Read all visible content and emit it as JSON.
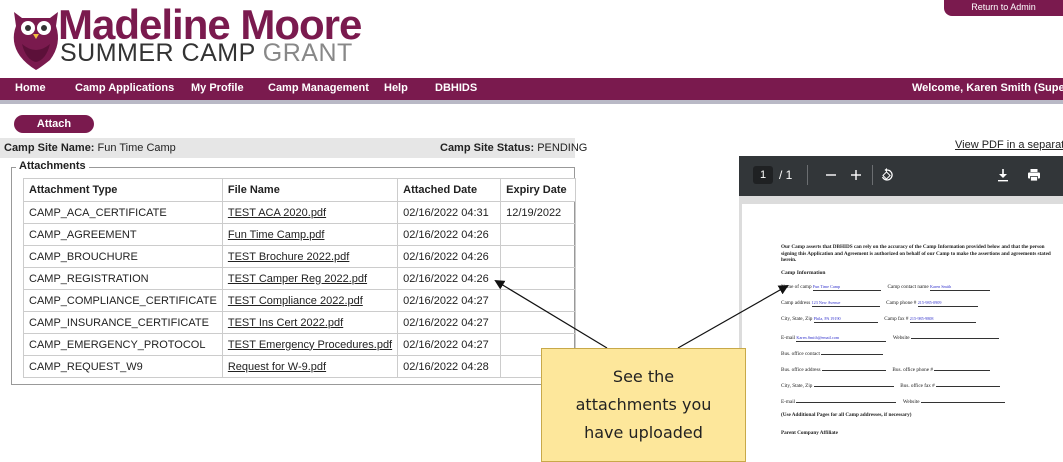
{
  "brand": {
    "name": "Madeline Moore",
    "sub_main": "SUMMER CAMP",
    "sub_light": "GRANT",
    "owl_icon": "owl-logo-icon",
    "color": "#7a1a4e"
  },
  "header": {
    "top_right_label": "Return to Admin"
  },
  "nav": {
    "items": [
      {
        "label": "Home"
      },
      {
        "label": "Camp Applications"
      },
      {
        "label": "My Profile"
      },
      {
        "label": "Camp Management"
      },
      {
        "label": "Help"
      },
      {
        "label": "DBHIDS"
      }
    ],
    "welcome": "Welcome, Karen Smith (Super Ac"
  },
  "actions": {
    "attach_label": "Attach"
  },
  "site": {
    "name_label": "Camp Site Name:",
    "name_value": "Fun Time Camp",
    "status_label": "Camp Site Status:",
    "status_value": "PENDING",
    "pdf_link": "View PDF in a separate wi"
  },
  "attachments": {
    "legend": "Attachments",
    "columns": [
      "Attachment Type",
      "File Name",
      "Attached Date",
      "Expiry Date"
    ],
    "rows": [
      {
        "type": "CAMP_ACA_CERTIFICATE",
        "file": "TEST ACA 2020.pdf",
        "attached": "02/16/2022 04:31",
        "expiry": "12/19/2022"
      },
      {
        "type": "CAMP_AGREEMENT",
        "file": "Fun Time Camp.pdf",
        "attached": "02/16/2022 04:26",
        "expiry": ""
      },
      {
        "type": "CAMP_BROUCHURE",
        "file": "TEST Brochure 2022.pdf",
        "attached": "02/16/2022 04:26",
        "expiry": ""
      },
      {
        "type": "CAMP_REGISTRATION",
        "file": "TEST Camper Reg 2022.pdf",
        "attached": "02/16/2022 04:26",
        "expiry": ""
      },
      {
        "type": "CAMP_COMPLIANCE_CERTIFICATE",
        "file": "TEST Compliance 2022.pdf",
        "attached": "02/16/2022 04:27",
        "expiry": ""
      },
      {
        "type": "CAMP_INSURANCE_CERTIFICATE",
        "file": "TEST Ins Cert 2022.pdf",
        "attached": "02/16/2022 04:27",
        "expiry": ""
      },
      {
        "type": "CAMP_EMERGENCY_PROTOCOL",
        "file": "TEST Emergency Procedures.pdf",
        "attached": "02/16/2022 04:27",
        "expiry": ""
      },
      {
        "type": "CAMP_REQUEST_W9",
        "file": "Request for W-9.pdf",
        "attached": "02/16/2022 04:28",
        "expiry": ""
      }
    ]
  },
  "viewer": {
    "page_current": "1",
    "page_total": "/ 1",
    "zoom_out_icon": "minus-icon",
    "zoom_in_icon": "plus-icon",
    "rotate_icon": "rotate-icon",
    "download_icon": "download-icon",
    "print_icon": "print-icon",
    "doc": {
      "intro": "Our Camp asserts that DBHIDS can rely on the accuracy of the Camp Information provided below and that the person signing this Application and Agreement is authorized on behalf of our Camp to make the assertions and agreements stated herein.",
      "heading": "Camp Information",
      "name_label": "Name of camp",
      "name_value": "Fun Time Camp",
      "contact_label": "Camp contact name",
      "contact_value": "Karen Smith",
      "address_label": "Camp address",
      "address_value": "123 New Avenue",
      "phone_label": "Camp phone #",
      "phone_value": "215-985-0909",
      "city_label": "City, State, Zip",
      "city_value": "Phila, PA 19190",
      "fax_label": "Camp fax #",
      "fax_value": "215-985-9808",
      "email_label": "E-mail",
      "email_value": "Karen.Smith@email.com",
      "website_label": "Website",
      "bus_contact_label": "Bus. office contact",
      "bus_address_label": "Bus. office address",
      "bus_phone_label": "Bus. office phone #",
      "bus_city_label": "City, State, Zip",
      "bus_fax_label": "Bus. office fax #",
      "bus_email_label": "E-mail",
      "bus_website_label": "Website",
      "note": "(Use Additional Pages for all Camp addresses, if necessary)",
      "parent_label": "Parent Company Affiliate"
    }
  },
  "callout": {
    "lines": [
      "See the",
      "attachments you",
      "have uploaded"
    ]
  }
}
